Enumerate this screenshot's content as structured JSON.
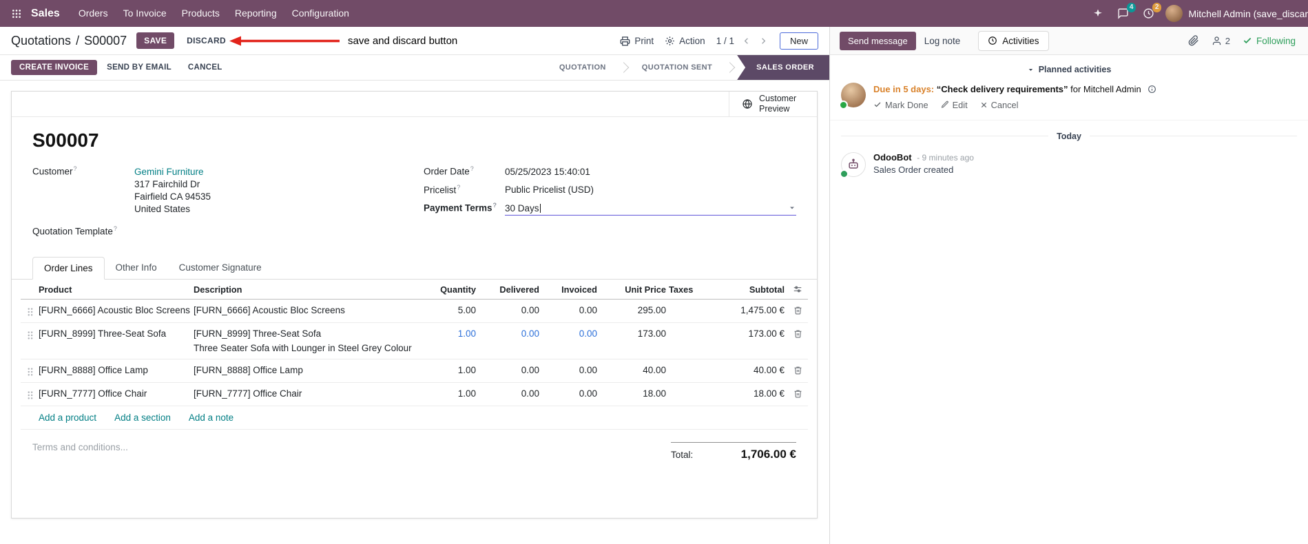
{
  "navbar": {
    "app_name": "Sales",
    "menus": [
      "Orders",
      "To Invoice",
      "Products",
      "Reporting",
      "Configuration"
    ],
    "systray": {
      "messages_count": "4",
      "activities_count": "2",
      "user_name": "Mitchell Admin (save_discar"
    }
  },
  "breadcrumb": {
    "path": "Quotations",
    "separator": "/",
    "record": "S00007"
  },
  "control_panel": {
    "save": "SAVE",
    "discard": "DISCARD",
    "print": "Print",
    "action": "Action",
    "pager": "1 / 1",
    "new": "New"
  },
  "annotation": {
    "text": "save and discard button"
  },
  "status_actions": {
    "create_invoice": "CREATE INVOICE",
    "send_by_email": "SEND BY EMAIL",
    "cancel": "CANCEL"
  },
  "statusbar": {
    "steps": [
      "QUOTATION",
      "QUOTATION SENT",
      "SALES ORDER"
    ],
    "active_step": "SALES ORDER"
  },
  "form": {
    "customer_preview": "Customer Preview",
    "title": "S00007",
    "help_marker": "?",
    "fields": {
      "customer_label": "Customer",
      "customer_value": "Gemini Furniture",
      "address_line1": "317 Fairchild Dr",
      "address_line2": "Fairfield CA 94535",
      "address_line3": "United States",
      "quotation_template_label": "Quotation Template",
      "order_date_label": "Order Date",
      "order_date_value": "05/25/2023 15:40:01",
      "pricelist_label": "Pricelist",
      "pricelist_value": "Public Pricelist (USD)",
      "payment_terms_label": "Payment Terms",
      "payment_terms_value": "30 Days"
    },
    "tabs": [
      "Order Lines",
      "Other Info",
      "Customer Signature"
    ],
    "order_lines": {
      "columns": [
        "Product",
        "Description",
        "Quantity",
        "Delivered",
        "Invoiced",
        "Unit Price",
        "Taxes",
        "Subtotal"
      ],
      "rows": [
        {
          "product": "[FURN_6666] Acoustic Bloc Screens",
          "description": "[FURN_6666] Acoustic Bloc Screens",
          "description2": "",
          "quantity": "5.00",
          "delivered": "0.00",
          "invoiced": "0.00",
          "unit_price": "295.00",
          "taxes": "",
          "subtotal": "1,475.00 €",
          "edited": false
        },
        {
          "product": "[FURN_8999] Three-Seat Sofa",
          "description": "[FURN_8999] Three-Seat Sofa",
          "description2": "Three Seater Sofa with Lounger in Steel Grey Colour",
          "quantity": "1.00",
          "delivered": "0.00",
          "invoiced": "0.00",
          "unit_price": "173.00",
          "taxes": "",
          "subtotal": "173.00 €",
          "edited": true
        },
        {
          "product": "[FURN_8888] Office Lamp",
          "description": "[FURN_8888] Office Lamp",
          "description2": "",
          "quantity": "1.00",
          "delivered": "0.00",
          "invoiced": "0.00",
          "unit_price": "40.00",
          "taxes": "",
          "subtotal": "40.00 €",
          "edited": false
        },
        {
          "product": "[FURN_7777] Office Chair",
          "description": "[FURN_7777] Office Chair",
          "description2": "",
          "quantity": "1.00",
          "delivered": "0.00",
          "invoiced": "0.00",
          "unit_price": "18.00",
          "taxes": "",
          "subtotal": "18.00 €",
          "edited": false
        }
      ],
      "add_links": [
        "Add a product",
        "Add a section",
        "Add a note"
      ]
    },
    "terms_placeholder": "Terms and conditions...",
    "total_label": "Total:",
    "total_value": "1,706.00 €"
  },
  "chatter": {
    "send_message": "Send message",
    "log_note": "Log note",
    "activities_tab": "Activities",
    "followers_count": "2",
    "following": "Following",
    "planned_title": "Planned activities",
    "activity": {
      "due": "Due in 5 days:",
      "summary": "“Check delivery requirements”",
      "for_assignee": "for Mitchell Admin",
      "mark_done": "Mark Done",
      "edit": "Edit",
      "cancel": "Cancel"
    },
    "today_divider": "Today",
    "message": {
      "author": "OdooBot",
      "time": "- 9 minutes ago",
      "body": "Sales Order created"
    }
  },
  "colors": {
    "brand_purple": "#714B67",
    "link_teal": "#017E84",
    "edited_value_blue": "#2B6FD9",
    "status_active_bg": "#5C4966",
    "annotation_red": "#E2231A",
    "due_orange": "#D9822B",
    "following_green": "#2E9E5B",
    "messages_badge": "#00A09D",
    "activities_badge": "#ECA539",
    "focus_underline": "#6157D8"
  }
}
